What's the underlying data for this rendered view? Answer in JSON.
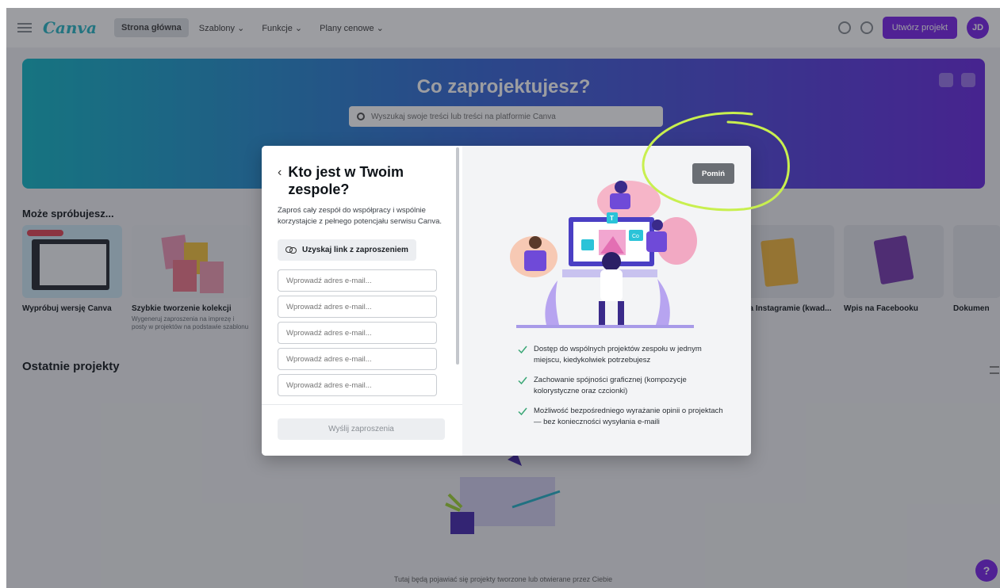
{
  "topbar": {
    "logo": "Canva",
    "nav": [
      "Strona główna",
      "Szablony ⌄",
      "Funkcje ⌄",
      "Plany cenowe ⌄"
    ],
    "create_label": "Utwórz projekt",
    "avatar_initials": "JD"
  },
  "hero": {
    "title": "Co zaprojektujesz?",
    "search_placeholder": "Wyszukaj swoje treści lub treści na platformie Canva"
  },
  "sections": {
    "try_title": "Może spróbujesz...",
    "recent_title": "Ostatnie projekty"
  },
  "templates": [
    {
      "caption": "Wypróbuj wersję Canva",
      "sub": ""
    },
    {
      "caption": "Szybkie tworzenie kolekcji",
      "sub": "Wygeneruj zaproszenia na imprezę i posty w projektów na podstawie szablonu"
    },
    {
      "caption": "",
      "sub": ""
    },
    {
      "caption": "Post na Instagramie (kwad...",
      "sub": ""
    },
    {
      "caption": "Wpis na Facebooku",
      "sub": ""
    },
    {
      "caption": "Dokumen",
      "sub": ""
    }
  ],
  "bottom_text": "Tutaj będą pojawiać się projekty tworzone lub otwierane przez Ciebie",
  "help_label": "?",
  "modal": {
    "back_icon": "chevron-left-icon",
    "title": "Kto jest w Twoim zespole?",
    "description": "Zaproś cały zespół do współpracy i wspólnie korzystajcie z pełnego potencjału serwisu Canva.",
    "invite_link_label": "Uzyskaj link z zaproszeniem",
    "email_placeholder": "Wprowadź adres e-mail...",
    "email_fields": [
      "",
      "",
      "",
      "",
      ""
    ],
    "send_label": "Wyślij zaproszenia",
    "skip_label": "Pomiń",
    "benefits": [
      "Dostęp do wspólnych projektów zespołu w jednym miejscu, kiedykolwiek potrzebujesz",
      "Zachowanie spójności graficznej (kompozycje kolorystyczne oraz czcionki)",
      "Możliwość bezpośredniego wyrażanie opinii o projektach — bez konieczności wysyłania e-maili"
    ],
    "illustration_badges": [
      "T",
      "Co"
    ]
  },
  "colors": {
    "brand_purple": "#7d2ae8",
    "check_green": "#3ba776",
    "highlight_lime": "#c8ef4f"
  }
}
